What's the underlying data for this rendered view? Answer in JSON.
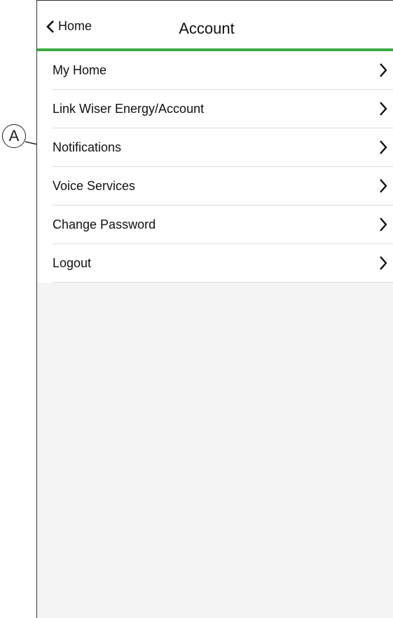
{
  "callout": {
    "label": "A"
  },
  "header": {
    "back_label": "Home",
    "title": "Account"
  },
  "menu": {
    "items": [
      {
        "label": "My Home"
      },
      {
        "label": "Link Wiser Energy/Account"
      },
      {
        "label": "Notifications"
      },
      {
        "label": "Voice Services"
      },
      {
        "label": "Change Password"
      },
      {
        "label": "Logout"
      }
    ]
  },
  "colors": {
    "accent": "#3dab41",
    "background": "#f4f4f4"
  }
}
